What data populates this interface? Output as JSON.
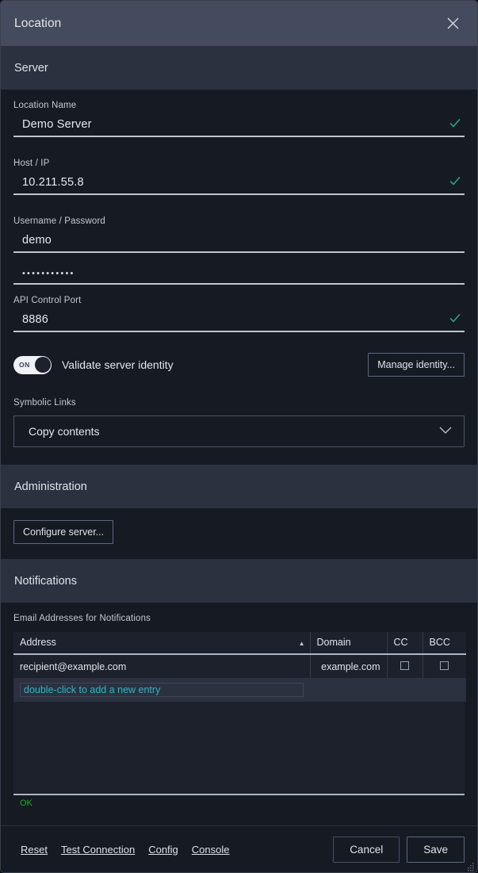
{
  "window": {
    "title": "Location",
    "close_icon": "close-icon"
  },
  "sections": {
    "server": "Server",
    "administration": "Administration",
    "notifications": "Notifications"
  },
  "server": {
    "location_name": {
      "label": "Location Name",
      "value": "Demo Server",
      "valid": "check-icon"
    },
    "host_ip": {
      "label": "Host / IP",
      "value": "10.211.55.8",
      "valid": "check-icon"
    },
    "credentials": {
      "label": "Username / Password",
      "username": "demo",
      "password_mask": "•••••••••••"
    },
    "api_port": {
      "label": "API Control Port",
      "value": "8886",
      "valid": "check-icon"
    },
    "validate_identity": {
      "toggle_state": "ON",
      "label": "Validate server identity",
      "manage_button": "Manage identity..."
    },
    "symbolic_links": {
      "label": "Symbolic Links",
      "selected": "Copy contents",
      "chevron": "chevron-down-icon"
    }
  },
  "administration": {
    "configure_button": "Configure server..."
  },
  "notifications": {
    "table_label": "Email Addresses for Notifications",
    "columns": [
      "Address",
      "Domain",
      "CC",
      "BCC"
    ],
    "sort_indicator": "▲",
    "rows": [
      {
        "address": "recipient@example.com",
        "domain": "example.com",
        "cc": false,
        "bcc": false
      }
    ],
    "new_entry_hint": "double-click to add a new entry",
    "status": "OK"
  },
  "footer": {
    "links": [
      "Reset",
      "Test Connection",
      "Config",
      "Console"
    ],
    "cancel": "Cancel",
    "save": "Save"
  },
  "colors": {
    "accent_check": "#2f9e8a",
    "status_ok": "#18b318",
    "new_entry_text": "#2fb6c6",
    "titlebar": "#454b5e",
    "section_header": "#2c3140",
    "body": "#161a23"
  }
}
